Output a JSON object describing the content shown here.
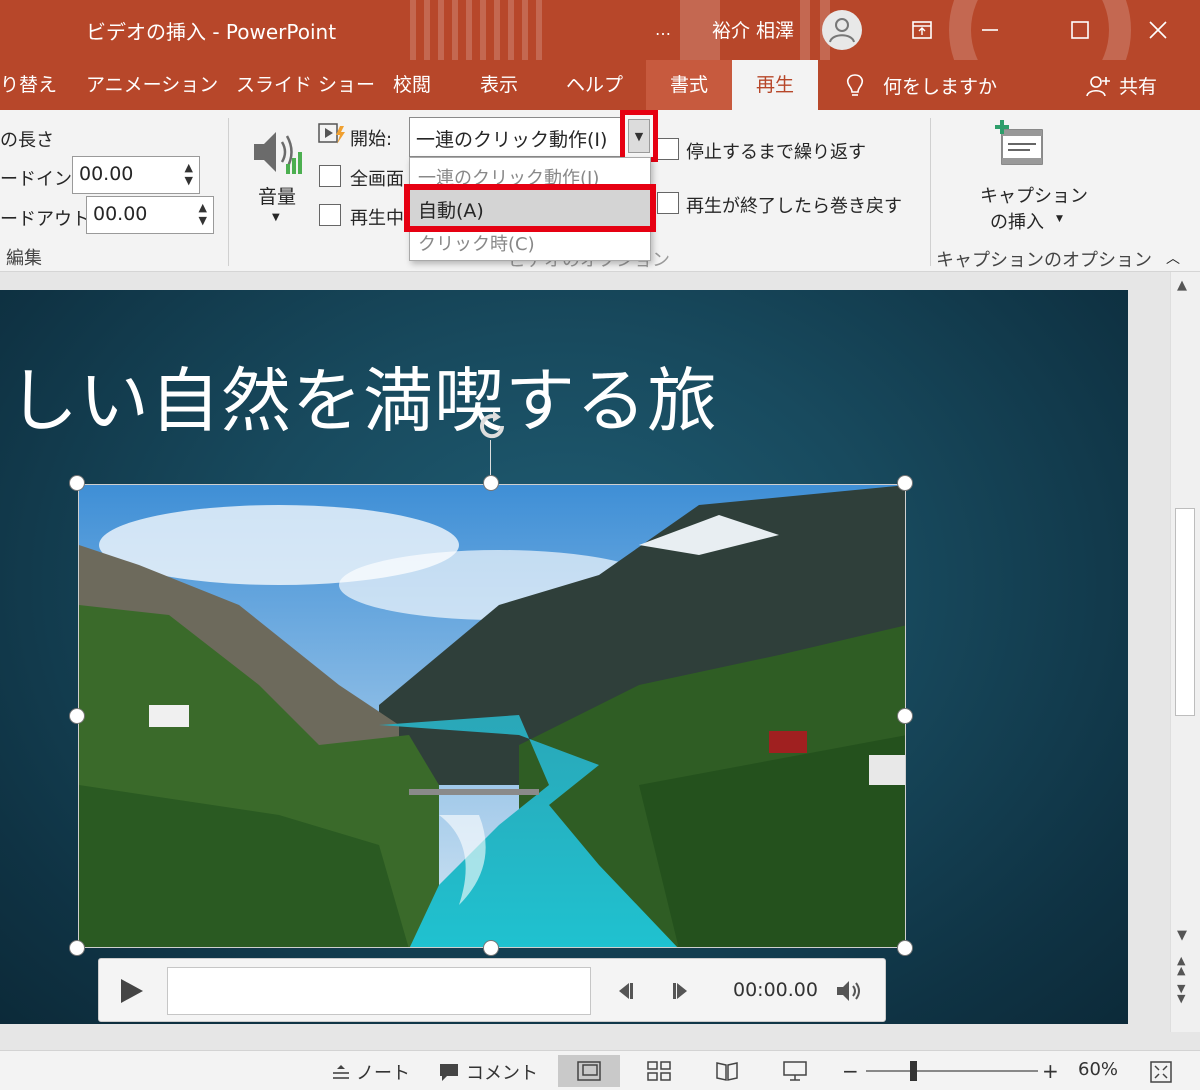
{
  "window": {
    "title": "ビデオの挿入  -  PowerPoint",
    "account_name": "裕介 相澤",
    "more_label": "…",
    "minimize_icon": "minimize-icon",
    "restore_icon": "ribbon-display-icon",
    "maximize_icon": "maximize-icon",
    "close_icon": "close-icon"
  },
  "tabs": {
    "transitions": "画面切り替え",
    "transitions_visible": "り替え",
    "animations": "アニメーション",
    "slideshow": "スライド ショー",
    "review": "校閲",
    "view": "表示",
    "help": "ヘルプ",
    "format": "書式",
    "playback": "再生",
    "tell_me": "何をしますか",
    "share": "共有"
  },
  "ribbon": {
    "duration_label": "の長さ",
    "fade_in_label": "ードイン:",
    "fade_in_value": "00.00",
    "fade_out_label": "ードアウト:",
    "fade_out_value": "00.00",
    "edit_group": "編集",
    "volume_label": "音量",
    "start_label": "開始:",
    "start_value": "一連のクリック動作(I)",
    "fullscreen_label": "全画面",
    "hide_label": "再生中",
    "loop_label": "停止するまで繰り返す",
    "rewind_label": "再生が終了したら巻き戻す",
    "video_options_group": "ビデオのオプション",
    "insert_caption_line1": "キャプション",
    "insert_caption_line2": "の挿入",
    "caption_options_group": "キャプションのオプション"
  },
  "dropdown": {
    "options": [
      "一連のクリック動作(I)",
      "自動(A)",
      "クリック時(C)"
    ],
    "highlighted": "自動(A)"
  },
  "slide": {
    "title": "しい自然を満喫する旅"
  },
  "player": {
    "time": "00:00.00"
  },
  "statusbar": {
    "notes": "ノート",
    "comments": "コメント",
    "zoom": "60%"
  },
  "colors": {
    "accent": "#b7472a",
    "highlight_red": "#e60012",
    "slide_bg": "#184a5e"
  }
}
